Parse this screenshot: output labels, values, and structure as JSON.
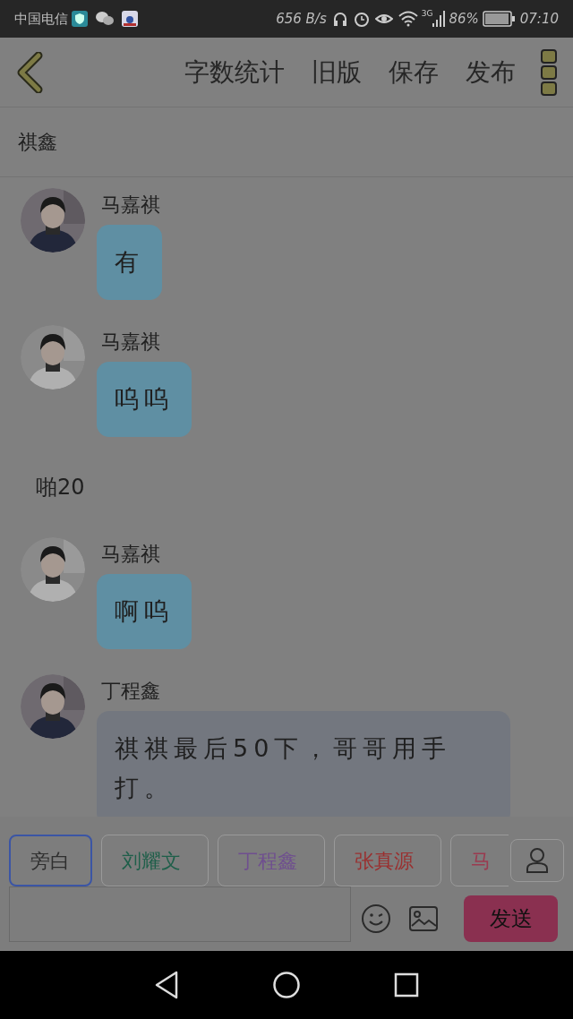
{
  "status_bar": {
    "carrier": "中国电信",
    "speed": "656 B/s",
    "network": "3G",
    "battery": "86%",
    "time": "07:10"
  },
  "header": {
    "actions": [
      "字数统计",
      "旧版",
      "保存",
      "发布"
    ]
  },
  "subtitle": "祺鑫",
  "messages": [
    {
      "kind": "message",
      "sender": "马嘉祺",
      "text": "有",
      "color": "#5f8fa3"
    },
    {
      "kind": "message",
      "sender": "马嘉祺",
      "text": "呜呜",
      "color": "#5f8fa3"
    },
    {
      "kind": "narration",
      "text": "啪20"
    },
    {
      "kind": "message",
      "sender": "马嘉祺",
      "text": "啊呜",
      "color": "#5f8fa3"
    },
    {
      "kind": "message",
      "sender": "丁程鑫",
      "text": "祺祺最后50下，哥哥用手打。",
      "color": "#73777f"
    }
  ],
  "roles": [
    {
      "label": "旁白",
      "selected": true,
      "color": "#2f2f2f"
    },
    {
      "label": "刘耀文",
      "selected": false,
      "color": "#1f5f4a"
    },
    {
      "label": "丁程鑫",
      "selected": false,
      "color": "#6f4f8f"
    },
    {
      "label": "张真源",
      "selected": false,
      "color": "#9a2f2f"
    },
    {
      "label": "马",
      "selected": false,
      "color": "#9a3a4f"
    }
  ],
  "composer": {
    "send": "发送"
  }
}
